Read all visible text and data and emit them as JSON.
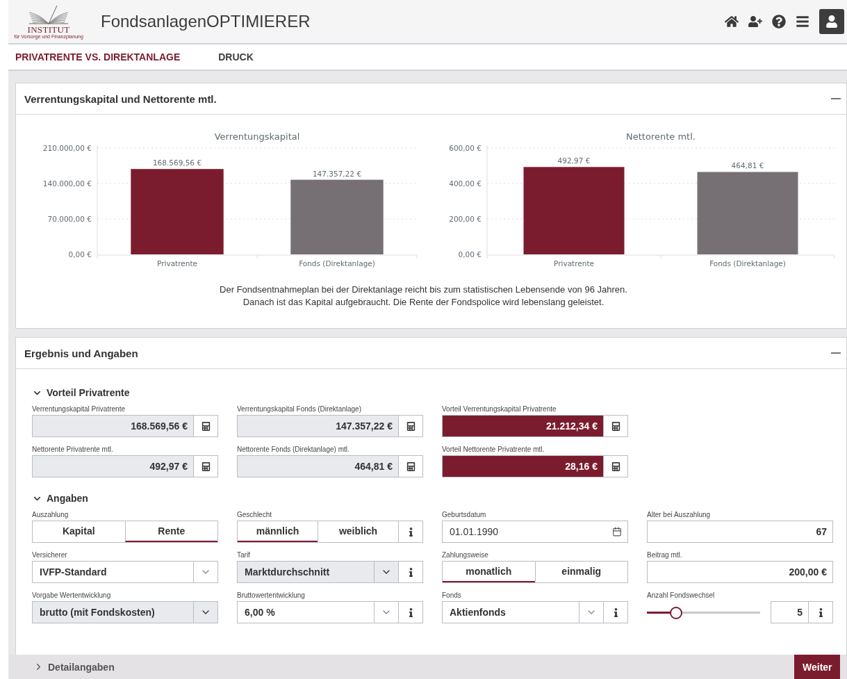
{
  "header": {
    "logo": {
      "name": "INSTITUT",
      "tagline": "für Vorsorge und Finanzplanung"
    },
    "title": "FondsanlagenOPTIMIERER"
  },
  "nav": [
    {
      "label": "PRIVATRENTE VS. DIREKTANLAGE",
      "selected": true
    },
    {
      "label": "DRUCK",
      "selected": false
    }
  ],
  "chart_panel": {
    "title": "Verrentungskapital und Nettorente mtl.",
    "expanded": true,
    "charts": [
      {
        "chart_data": {
          "type": "bar",
          "title": "Verrentungskapital",
          "categories": [
            "Privatrente",
            "Fonds (Direktanlage)"
          ],
          "values": [
            168569.56,
            147357.22
          ],
          "colors": [
            "#7b1c2e",
            "#767074"
          ],
          "value_labels": [
            "168.569,56 €",
            "147.357,22 €"
          ],
          "ylim": [
            0,
            210000
          ],
          "yticks": [
            {
              "value": 0,
              "label": "0,00 €"
            },
            {
              "value": 70000,
              "label": "70.000,00 €"
            },
            {
              "value": 140000,
              "label": "140.000,00 €"
            },
            {
              "value": 210000,
              "label": "210.000,00 €"
            }
          ]
        }
      },
      {
        "chart_data": {
          "type": "bar",
          "title": "Nettorente mtl.",
          "categories": [
            "Privatrente",
            "Fonds (Direktanlage)"
          ],
          "values": [
            492.97,
            464.81
          ],
          "colors": [
            "#7b1c2e",
            "#767074"
          ],
          "value_labels": [
            "492,97 €",
            "464,81 €"
          ],
          "ylim": [
            0,
            600
          ],
          "yticks": [
            {
              "value": 0,
              "label": "0,00 €"
            },
            {
              "value": 200,
              "label": "200,00 €"
            },
            {
              "value": 400,
              "label": "400,00 €"
            },
            {
              "value": 600,
              "label": "600,00 €"
            }
          ]
        }
      }
    ],
    "note": [
      "Der Fondsentnahmeplan bei der Direktanlage reicht bis zum statistischen Lebensende von 96 Jahren.",
      "Danach ist das Kapital aufgebraucht. Die Rente der Fondspolice wird lebenslang geleistet."
    ]
  },
  "result_panel": {
    "title": "Ergebnis und Angaben",
    "expanded": true,
    "sections": [
      {
        "title": "Vorteil Privatrente",
        "expanded": true,
        "fields": [
          {
            "kind": "output",
            "label": "Verrentungskapital Privatrente",
            "value": "168.569,56 €",
            "highlighted": false
          },
          {
            "kind": "output",
            "label": "Verrentungskapital Fonds (Direktanlage)",
            "value": "147.357,22 €",
            "highlighted": false
          },
          {
            "kind": "output",
            "label": "Vorteil Verrentungskapital Privatrente",
            "value": "21.212,34 €",
            "highlighted": true
          },
          {
            "kind": "break"
          },
          {
            "kind": "output",
            "label": "Nettorente Privatrente mtl.",
            "value": "492,97 €",
            "highlighted": false
          },
          {
            "kind": "output",
            "label": "Nettorente Fonds (Direktanlage) mtl.",
            "value": "464,81 €",
            "highlighted": false
          },
          {
            "kind": "output",
            "label": "Vorteil Nettorente Privatrente mtl.",
            "value": "28,16 €",
            "highlighted": true
          }
        ]
      },
      {
        "title": "Angaben",
        "expanded": true,
        "fields": [
          {
            "kind": "segmented",
            "label": "Auszahlung",
            "info": false,
            "options": [
              {
                "label": "Kapital",
                "selected": false
              },
              {
                "label": "Rente",
                "selected": true
              }
            ]
          },
          {
            "kind": "segmented",
            "label": "Geschlecht",
            "info": true,
            "options": [
              {
                "label": "männlich",
                "selected": true
              },
              {
                "label": "weiblich",
                "selected": false
              }
            ]
          },
          {
            "kind": "date",
            "label": "Geburtsdatum",
            "value": "01.01.1990"
          },
          {
            "kind": "number",
            "label": "Alter bei Auszahlung",
            "value": "67"
          },
          {
            "kind": "select",
            "label": "Versicherer",
            "value": "IVFP-Standard",
            "readonly": false,
            "info": false
          },
          {
            "kind": "select",
            "label": "Tarif",
            "value": "Marktdurchschnitt",
            "readonly": true,
            "info": true
          },
          {
            "kind": "segmented",
            "label": "Zahlungsweise",
            "info": false,
            "options": [
              {
                "label": "monatlich",
                "selected": true
              },
              {
                "label": "einmalig",
                "selected": false
              }
            ]
          },
          {
            "kind": "number",
            "label": "Beitrag mtl.",
            "value": "200,00 €"
          },
          {
            "kind": "select",
            "label": "Vorgabe Wertentwicklung",
            "value": "brutto (mit Fondskosten)",
            "readonly": true,
            "info": false
          },
          {
            "kind": "select",
            "label": "Bruttowertentwicklung",
            "value": "6,00 %",
            "readonly": false,
            "info": true
          },
          {
            "kind": "select",
            "label": "Fonds",
            "value": "Aktienfonds",
            "readonly": false,
            "info": true
          },
          {
            "kind": "slider",
            "label": "Anzahl Fondswechsel",
            "level": 0.25,
            "value": "5",
            "info": true
          }
        ]
      }
    ]
  },
  "footer": {
    "details": {
      "label": "Detailangaben",
      "expanded": false
    },
    "next_button": "Weiter"
  }
}
